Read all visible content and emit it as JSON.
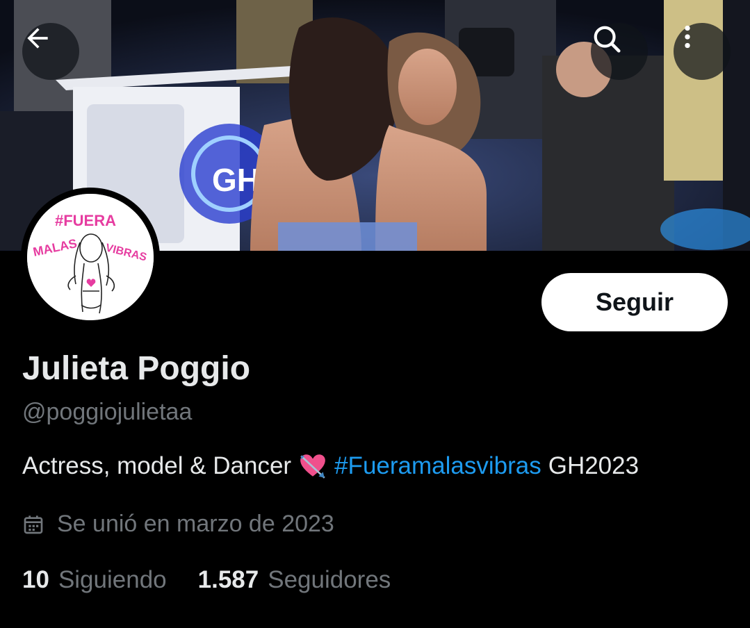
{
  "banner": {
    "logo_text": "GH"
  },
  "icons": {
    "back": "arrow-left-icon",
    "search": "search-icon",
    "more": "more-vertical-icon",
    "calendar": "calendar-icon",
    "emoji": "heart-with-arrow-emoji"
  },
  "avatar": {
    "line1": "#FUERA",
    "line2": "MALAS",
    "line3": "VIBRAS"
  },
  "profile": {
    "follow_label": "Seguir",
    "display_name": "Julieta Poggio",
    "handle": "@poggiojulietaa",
    "bio_text": "Actress, model & Dancer",
    "bio_hashtag": "#Fueramalasvibras",
    "bio_suffix": "GH2023",
    "joined": "Se unió en marzo de 2023",
    "following_count": "10",
    "following_label": "Siguiendo",
    "followers_count": "1.587",
    "followers_label": "Seguidores"
  },
  "colors": {
    "background": "#000000",
    "primary_text": "#e7e9ea",
    "secondary_text": "#71767b",
    "link": "#1d9bf0",
    "button_bg": "#ffffff"
  }
}
